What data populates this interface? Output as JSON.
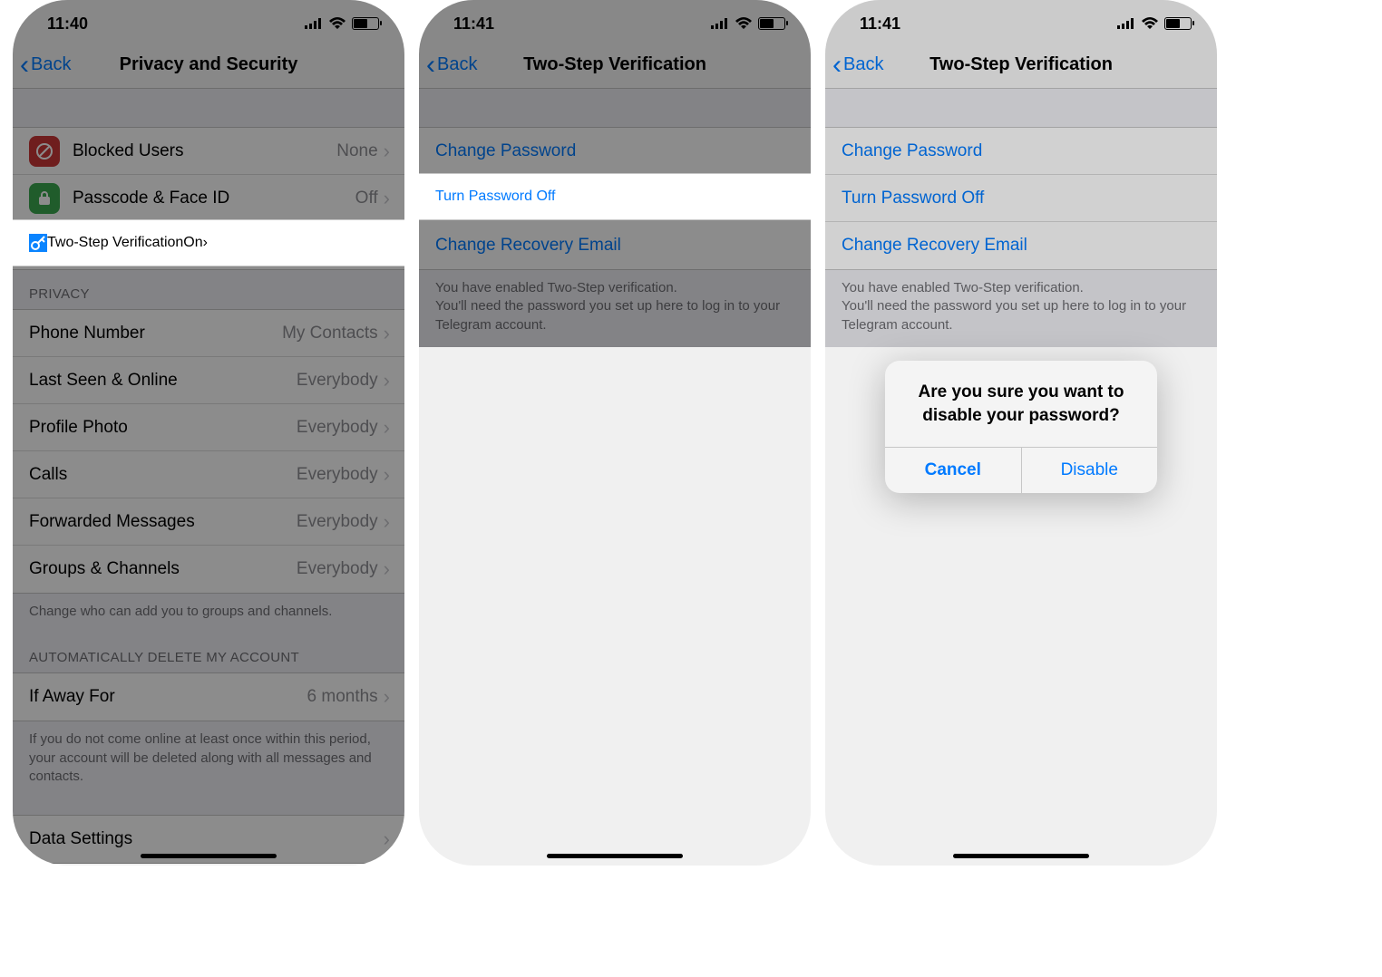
{
  "screens": [
    {
      "time": "11:40",
      "back_label": "Back",
      "title": "Privacy and Security",
      "security_rows": [
        {
          "label": "Blocked Users",
          "value": "None",
          "icon": "blocked-icon",
          "icon_bg": "icon-red"
        },
        {
          "label": "Passcode & Face ID",
          "value": "Off",
          "icon": "passcode-icon",
          "icon_bg": "icon-green"
        },
        {
          "label": "Two-Step Verification",
          "value": "On",
          "icon": "key-icon",
          "icon_bg": "icon-blue"
        }
      ],
      "privacy_header": "PRIVACY",
      "privacy_rows": [
        {
          "label": "Phone Number",
          "value": "My Contacts"
        },
        {
          "label": "Last Seen & Online",
          "value": "Everybody"
        },
        {
          "label": "Profile Photo",
          "value": "Everybody"
        },
        {
          "label": "Calls",
          "value": "Everybody"
        },
        {
          "label": "Forwarded Messages",
          "value": "Everybody"
        },
        {
          "label": "Groups & Channels",
          "value": "Everybody"
        }
      ],
      "privacy_footer": "Change who can add you to groups and channels.",
      "auto_delete_header": "AUTOMATICALLY DELETE MY ACCOUNT",
      "auto_delete_row": {
        "label": "If Away For",
        "value": "6 months"
      },
      "auto_delete_footer": "If you do not come online at least once within this period, your account will be deleted along with all messages and contacts.",
      "data_settings_label": "Data Settings"
    },
    {
      "time": "11:41",
      "back_label": "Back",
      "title": "Two-Step Verification",
      "links": [
        "Change Password",
        "Turn Password Off",
        "Change Recovery Email"
      ],
      "footer": "You have enabled Two-Step verification.\nYou'll need the password you set up here to log in to your Telegram account."
    },
    {
      "time": "11:41",
      "back_label": "Back",
      "title": "Two-Step Verification",
      "links": [
        "Change Password",
        "Turn Password Off",
        "Change Recovery Email"
      ],
      "footer": "You have enabled Two-Step verification.\nYou'll need the password you set up here to log in to your Telegram account.",
      "alert_title": "Are you sure you want to disable your password?",
      "alert_cancel": "Cancel",
      "alert_confirm": "Disable"
    }
  ]
}
